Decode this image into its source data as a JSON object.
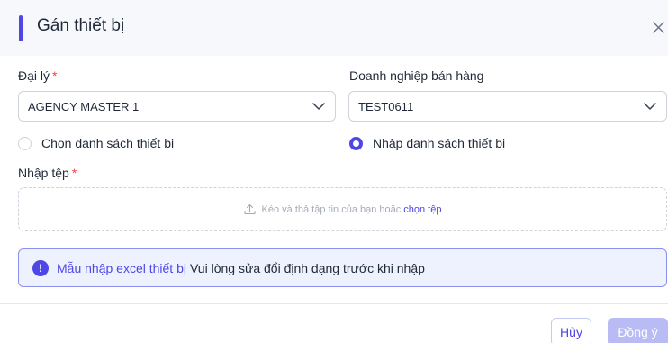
{
  "dialog": {
    "title": "Gán thiết bị",
    "close_icon": "close-icon"
  },
  "agent": {
    "label": "Đại lý",
    "required": "*",
    "value": "AGENCY MASTER 1"
  },
  "company": {
    "label": "Doanh nghiệp bán hàng",
    "value": "TEST0611"
  },
  "mode": {
    "option_select": "Chọn danh sách thiết bị",
    "option_input": "Nhập danh sách thiết bị",
    "selected": "option_input"
  },
  "file": {
    "label": "Nhập tệp",
    "required": "*",
    "drop_text": "Kéo và thả tập tin của bạn hoặc",
    "choose_link": "chọn tệp",
    "icon": "upload-icon"
  },
  "alert": {
    "icon": "info-icon",
    "icon_glyph": "!",
    "link": "Mẫu nhập excel thiết bị",
    "message": "Vui lòng sửa đổi định dạng trước khi nhập"
  },
  "footer": {
    "cancel_label": "Hủy",
    "ok_label": "Đồng ý"
  },
  "colors": {
    "accent": "#4f46e5",
    "required": "#ef4444",
    "alert_bg": "#eef2ff",
    "disabled_button": "#b9bcf4"
  }
}
